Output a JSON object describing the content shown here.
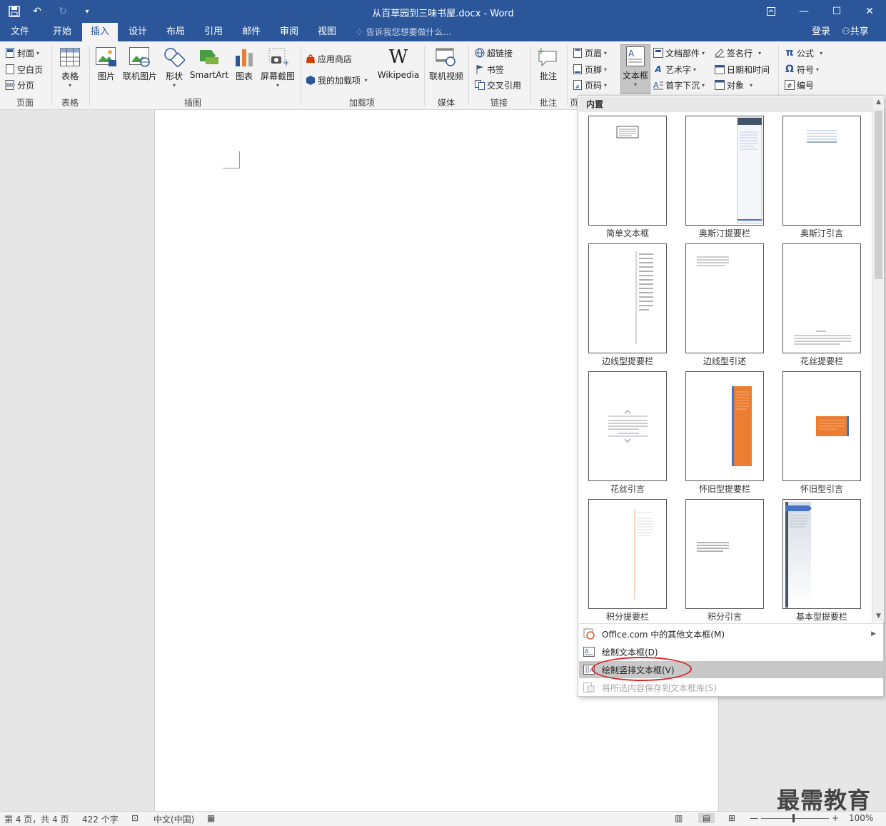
{
  "window": {
    "title": "从百草园到三味书屋.docx - Word",
    "brand_color": "#2b579a"
  },
  "tabs": [
    {
      "label": "文件"
    },
    {
      "label": "开始"
    },
    {
      "label": "插入",
      "active": true
    },
    {
      "label": "设计"
    },
    {
      "label": "布局"
    },
    {
      "label": "引用"
    },
    {
      "label": "邮件"
    },
    {
      "label": "审阅"
    },
    {
      "label": "视图"
    }
  ],
  "tell_me": "告诉我您想要做什么...",
  "account": {
    "login": "登录",
    "share": "共享"
  },
  "ribbon": {
    "pages": {
      "cover": "封面",
      "blank": "空白页",
      "break": "分页",
      "label": "页面"
    },
    "tables": {
      "table": "表格",
      "label": "表格"
    },
    "illustrations": {
      "picture": "图片",
      "online_picture": "联机图片",
      "shapes": "形状",
      "smartart": "SmartArt",
      "chart": "图表",
      "screenshot": "屏幕截图",
      "label": "插图"
    },
    "addins": {
      "store": "应用商店",
      "my_addins": "我的加载项",
      "wikipedia": "Wikipedia",
      "label": "加载项"
    },
    "media": {
      "online_video": "联机视频",
      "label": "媒体"
    },
    "links": {
      "hyperlink": "超链接",
      "bookmark": "书签",
      "crossref": "交叉引用",
      "label": "链接"
    },
    "comments": {
      "comment": "批注",
      "label": "批注"
    },
    "header_footer": {
      "header": "页眉",
      "footer": "页脚",
      "page_number": "页码",
      "label": "页"
    },
    "text": {
      "textbox": "文本框",
      "quickparts": "文档部件",
      "wordart": "艺术字",
      "dropcap": "首字下沉",
      "signature": "签名行",
      "datetime": "日期和时间",
      "object": "对象"
    },
    "symbols": {
      "equation": "公式",
      "symbol": "符号",
      "number": "编号"
    }
  },
  "dropdown": {
    "header": "内置",
    "thumbnails": [
      {
        "label": "简单文本框"
      },
      {
        "label": "奥斯汀提要栏"
      },
      {
        "label": "奥斯汀引言"
      },
      {
        "label": "边线型提要栏"
      },
      {
        "label": "边线型引述"
      },
      {
        "label": "花丝提要栏"
      },
      {
        "label": "花丝引言"
      },
      {
        "label": "怀旧型提要栏"
      },
      {
        "label": "怀旧型引言"
      },
      {
        "label": "积分提要栏"
      },
      {
        "label": "积分引言"
      },
      {
        "label": "基本型提要栏"
      }
    ],
    "menu": {
      "more_office": "Office.com 中的其他文本框(M)",
      "draw_textbox": "绘制文本框(D)",
      "draw_vertical": "绘制竖排文本框(V)",
      "save_selection": "将所选内容保存到文本框库(S)"
    },
    "accent_orange": "#ed7d31",
    "highlight_color": "#d9262c"
  },
  "status": {
    "page": "第 4 页，共 4 页",
    "words": "422 个字",
    "language": "中文(中国)",
    "zoom": "100%"
  },
  "watermark": "最需教育"
}
